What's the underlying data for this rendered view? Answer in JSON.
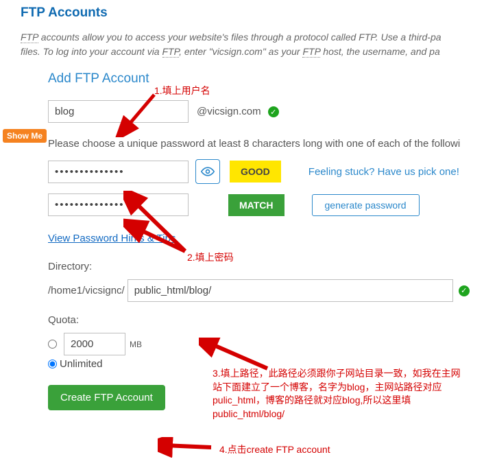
{
  "title": "FTP Accounts",
  "intro_line1_a": "FTP",
  "intro_line1_b": " accounts allow you to access your website's files through a protocol called FTP. Use a third-pa",
  "intro_line2_a": "files. To log into your account via ",
  "intro_line2_b": "FTP",
  "intro_line2_c": ", enter \"vicsign.com\" as your ",
  "intro_line2_d": "FTP",
  "intro_line2_e": " host, the username, and pa",
  "section_heading": "Add FTP Account",
  "show_me": "Show Me",
  "login_value": "blog",
  "at_domain": "@vicsign.com",
  "pw_hint": "Please choose a unique password at least 8 characters long with one of each of the followi",
  "password_value": "••••••••••••••",
  "password_confirm_value": "••••••••••••••",
  "strength_label": "GOOD",
  "match_label": "MATCH",
  "stuck_text": "Feeling stuck? Have us pick one!",
  "generate_label": "generate password",
  "pw_hints_link": "View Password Hints & Tips",
  "directory_label": "Directory:",
  "directory_prefix": "/home1/vicsignc/",
  "directory_value": "public_html/blog/",
  "quota_label": "Quota:",
  "quota_value": "2000",
  "quota_unit": "MB",
  "unlimited_label": "Unlimited",
  "create_label": "Create FTP Account",
  "anno1": "1.填上用户名",
  "anno2": "2.填上密码",
  "anno3": "3.填上路径，此路径必须跟你子网站目录一致，如我在主网站下面建立了一个博客，名字为blog，主网站路径对应pulic_html，博客的路径就对应blog,所以这里填public_html/blog/",
  "anno4": "4.点击create FTP account"
}
